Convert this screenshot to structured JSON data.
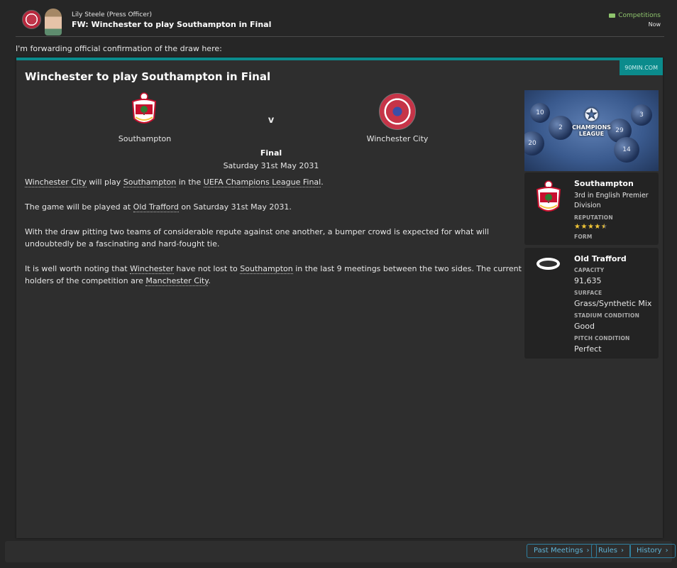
{
  "header": {
    "sender": "Lily Steele  (Press Officer)",
    "subject": "FW: Winchester to play Southampton in Final",
    "competitions_link": "Competitions",
    "time": "Now"
  },
  "intro": "I'm forwarding official confirmation of the draw here:",
  "article": {
    "source": "90MIN.COM",
    "title": "Winchester to play Southampton in Final",
    "home_team": "Southampton",
    "versus": "v",
    "away_team": "Winchester City",
    "stage": "Final",
    "date": "Saturday 31st May 2031",
    "p1": {
      "team_a": "Winchester City",
      "t1": " will play ",
      "team_b": "Southampton",
      "t2": " in the ",
      "competition": "UEFA Champions League Final",
      "t3": "."
    },
    "p2": {
      "t1": "The game will be played at ",
      "venue": "Old Trafford",
      "t2": " on Saturday 31st May 2031."
    },
    "p3": "With the draw pitting two teams of considerable repute against one another, a bumper crowd is expected for what will undoubtedly be a fascinating and hard-fought tie.",
    "p4": {
      "t1": "It is well worth noting that ",
      "team_a": "Winchester",
      "t2": " have not lost to ",
      "team_b": "Southampton",
      "t3": " in the last 9 meetings between the two sides. The current holders of the competition are ",
      "holders": "Manchester City",
      "t4": "."
    }
  },
  "side": {
    "image_balls": [
      "20",
      "2",
      "29",
      "10",
      "14",
      "3"
    ],
    "image_logo": "CHAMPIONS LEAGUE",
    "club": {
      "name": "Southampton",
      "position": "3rd in English Premier Division",
      "reputation_label": "REPUTATION",
      "reputation_stars": 4.5,
      "form_label": "FORM"
    },
    "stadium": {
      "name": "Old Trafford",
      "capacity_label": "CAPACITY",
      "capacity": "91,635",
      "surface_label": "SURFACE",
      "surface": "Grass/Synthetic Mix",
      "condition_label": "STADIUM CONDITION",
      "condition": "Good",
      "pitch_label": "PITCH CONDITION",
      "pitch": "Perfect"
    }
  },
  "footer": {
    "past_meetings": "Past Meetings",
    "rules": "Rules",
    "history": "History"
  },
  "colors": {
    "accent": "#0b8b8c",
    "link_green": "#8fc56d",
    "button_blue": "#5fb3d6",
    "star": "#f0c537"
  }
}
